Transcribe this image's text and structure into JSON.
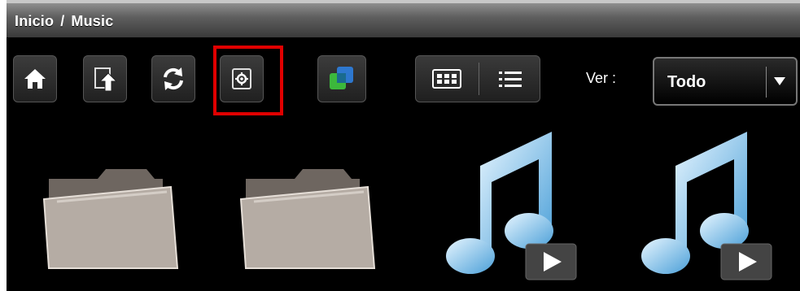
{
  "breadcrumb": {
    "home": "Inicio",
    "separator": "/",
    "current": "Music"
  },
  "toolbar": {
    "buttons": [
      "home-icon",
      "upload-icon",
      "refresh-icon",
      "settings-icon",
      "apps-icon"
    ],
    "highlighted": "settings-icon",
    "view_modes": [
      "grid-view-icon",
      "list-view-icon"
    ]
  },
  "filter": {
    "label": "Ver :",
    "selected": "Todo"
  },
  "items": [
    {
      "type": "folder"
    },
    {
      "type": "folder"
    },
    {
      "type": "music-video"
    },
    {
      "type": "music-video"
    }
  ],
  "colors": {
    "accent_highlight": "#e00000",
    "background": "#000000"
  }
}
